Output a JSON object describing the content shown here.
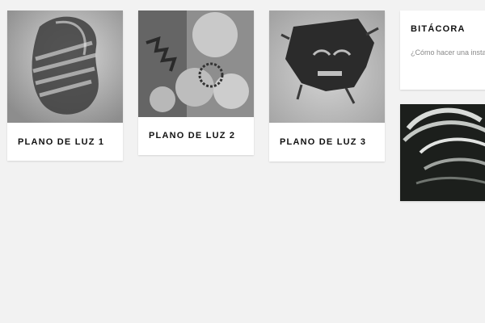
{
  "projects": [
    {
      "title": "PLANO DE LUZ 1",
      "image_icon": "paper-sculpture-photo"
    },
    {
      "title": "PLANO DE LUZ 2",
      "image_icon": "gear-shadow-photo"
    },
    {
      "title": "PLANO DE LUZ 3",
      "image_icon": "paper-cut-face-photo"
    }
  ],
  "blog": {
    "title": "BITÁCORA",
    "excerpt": "¿Cómo hacer una instal de Hugo?"
  },
  "featured": {
    "image_icon": "paper-ribbon-photo"
  }
}
